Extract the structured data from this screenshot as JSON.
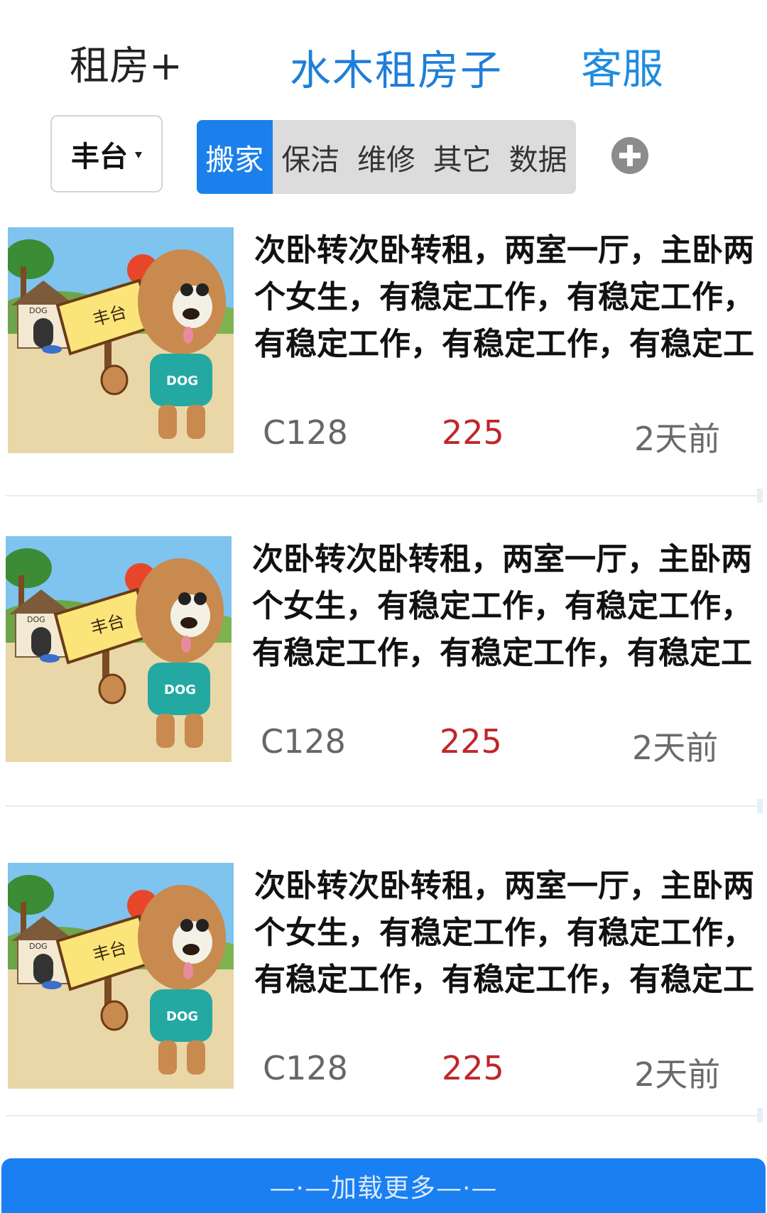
{
  "header": {
    "left_label": "租房+",
    "title": "水木租房子",
    "right_label": "客服"
  },
  "filter": {
    "district": "丰台",
    "tabs": [
      {
        "label": "搬家",
        "active": true
      },
      {
        "label": "保洁",
        "active": false
      },
      {
        "label": "维修",
        "active": false
      },
      {
        "label": "其它",
        "active": false
      },
      {
        "label": "数据",
        "active": false
      }
    ],
    "add_icon": "plus-circle-icon"
  },
  "listings": [
    {
      "title": "次卧转次卧转租，两室一厅，主卧两个女生，有稳定工作，有稳定工作，有稳定工作，有稳定工作，有稳定工作",
      "sign_text": "丰台",
      "shirt_text": "DOG",
      "house_text": "DOG",
      "code": "C128",
      "price": "225",
      "time": "2天前"
    },
    {
      "title": "次卧转次卧转租，两室一厅，主卧两个女生，有稳定工作，有稳定工作，有稳定工作，有稳定工作，有稳定工作",
      "sign_text": "丰台",
      "shirt_text": "DOG",
      "house_text": "DOG",
      "code": "C128",
      "price": "225",
      "time": "2天前"
    },
    {
      "title": "次卧转次卧转租，两室一厅，主卧两个女生，有稳定工作，有稳定工作，有稳定工作，有稳定工作，有稳定工作",
      "sign_text": "丰台",
      "shirt_text": "DOG",
      "house_text": "DOG",
      "code": "C128",
      "price": "225",
      "time": "2天前"
    }
  ],
  "load_more": "—·—加载更多—·—",
  "colors": {
    "accent": "#1c80ec",
    "price": "#c0262a",
    "title_blue": "#1e7fd8"
  }
}
